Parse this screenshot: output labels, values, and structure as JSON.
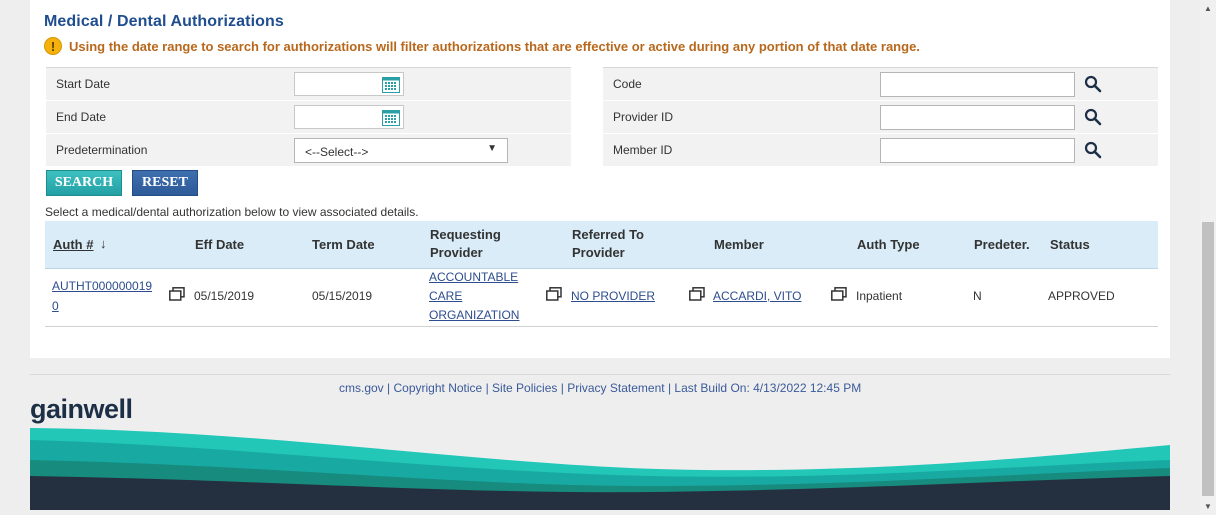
{
  "section": {
    "title": "Medical / Dental Authorizations",
    "warning": "Using the date range to search for authorizations will filter authorizations that are effective or active during any portion of that date range."
  },
  "filters": {
    "start_date": {
      "label": "Start Date",
      "value": ""
    },
    "end_date": {
      "label": "End Date",
      "value": ""
    },
    "predetermination": {
      "label": "Predetermination",
      "selected": "<--Select-->"
    },
    "code": {
      "label": "Code",
      "value": ""
    },
    "provider_id": {
      "label": "Provider ID",
      "value": ""
    },
    "member_id": {
      "label": "Member ID",
      "value": ""
    }
  },
  "buttons": {
    "search": "SEARCH",
    "reset": "RESET"
  },
  "hint": "Select a medical/dental authorization below to view associated details.",
  "table": {
    "headers": {
      "auth": "Auth #",
      "eff_date": "Eff Date",
      "term_date": "Term Date",
      "req_provider_1": "Requesting",
      "req_provider_2": "Provider",
      "ref_provider_1": "Referred To",
      "ref_provider_2": "Provider",
      "member": "Member",
      "auth_type": "Auth Type",
      "predeter": "Predeter.",
      "status": "Status"
    },
    "sort_arrow": "↓",
    "rows": [
      {
        "auth_1": "AUTHT000000019",
        "auth_2": "0",
        "eff_date": "05/15/2019",
        "term_date": "05/15/2019",
        "req_1": "ACCOUNTABLE",
        "req_2": "CARE",
        "req_3": "ORGANIZATION",
        "referred_to": "NO PROVIDER",
        "member": "ACCARDI, VITO",
        "auth_type": "Inpatient",
        "predeter": "N",
        "status": "APPROVED"
      }
    ]
  },
  "footer": {
    "links": [
      "cms.gov",
      "Copyright Notice",
      "Site Policies",
      "Privacy Statement"
    ],
    "last_build": "Last Build On: 4/13/2022 12:45 PM",
    "separator": "|",
    "logo": "gainwell"
  },
  "colors": {
    "title": "#1f4d8f",
    "warning": "#b8681c",
    "search_button": "#2aa8ab",
    "reset_button": "#3464a4",
    "table_header_bg": "#d9ecf7",
    "link": "#2d4d8e"
  }
}
